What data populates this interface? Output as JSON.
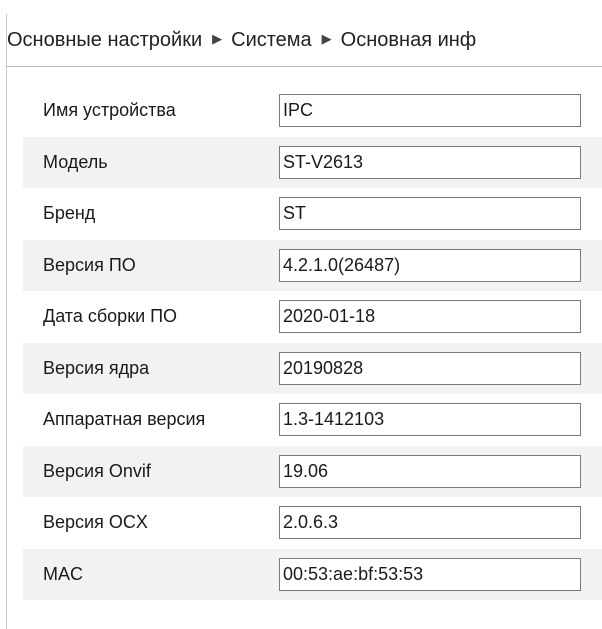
{
  "breadcrumb": {
    "items": [
      "Основные настройки",
      "Система",
      "Основная инф"
    ],
    "separator": "▶"
  },
  "fields": [
    {
      "label": "Имя устройства",
      "value": "IPC"
    },
    {
      "label": "Модель",
      "value": "ST-V2613"
    },
    {
      "label": "Бренд",
      "value": "ST"
    },
    {
      "label": "Версия ПО",
      "value": "4.2.1.0(26487)"
    },
    {
      "label": "Дата сборки ПО",
      "value": "2020-01-18"
    },
    {
      "label": "Версия ядра",
      "value": "20190828"
    },
    {
      "label": "Аппаратная версия",
      "value": "1.3-1412103"
    },
    {
      "label": "Версия Onvif",
      "value": "19.06"
    },
    {
      "label": "Версия OCX",
      "value": "2.0.6.3"
    },
    {
      "label": "MAC",
      "value": "00:53:ae:bf:53:53"
    }
  ],
  "colors": {
    "row_alt_background": "#f2f2f2",
    "field_border": "#7a7a7a",
    "divider": "#b8b8b8"
  }
}
